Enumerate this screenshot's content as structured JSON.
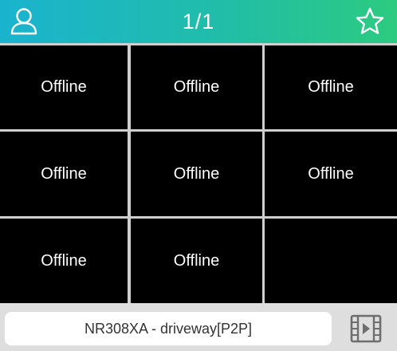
{
  "header": {
    "title": "1/1",
    "icons": {
      "left": "user-icon",
      "right": "star-icon"
    }
  },
  "grid": {
    "cells": [
      {
        "status": "Offline"
      },
      {
        "status": "Offline"
      },
      {
        "status": "Offline"
      },
      {
        "status": "Offline"
      },
      {
        "status": "Offline"
      },
      {
        "status": "Offline"
      },
      {
        "status": "Offline"
      },
      {
        "status": "Offline"
      },
      {
        "status": ""
      }
    ]
  },
  "footer": {
    "device_label": "NR308XA - driveway[P2P]",
    "icons": {
      "right": "playback-film-icon"
    }
  },
  "colors": {
    "header_gradient_start": "#1ab3cf",
    "header_gradient_end": "#2ccb80",
    "cell_background": "#000000",
    "grid_lines": "#cfcfcf",
    "footer_background": "#dedede",
    "playback_icon": "#6e6e6e"
  }
}
